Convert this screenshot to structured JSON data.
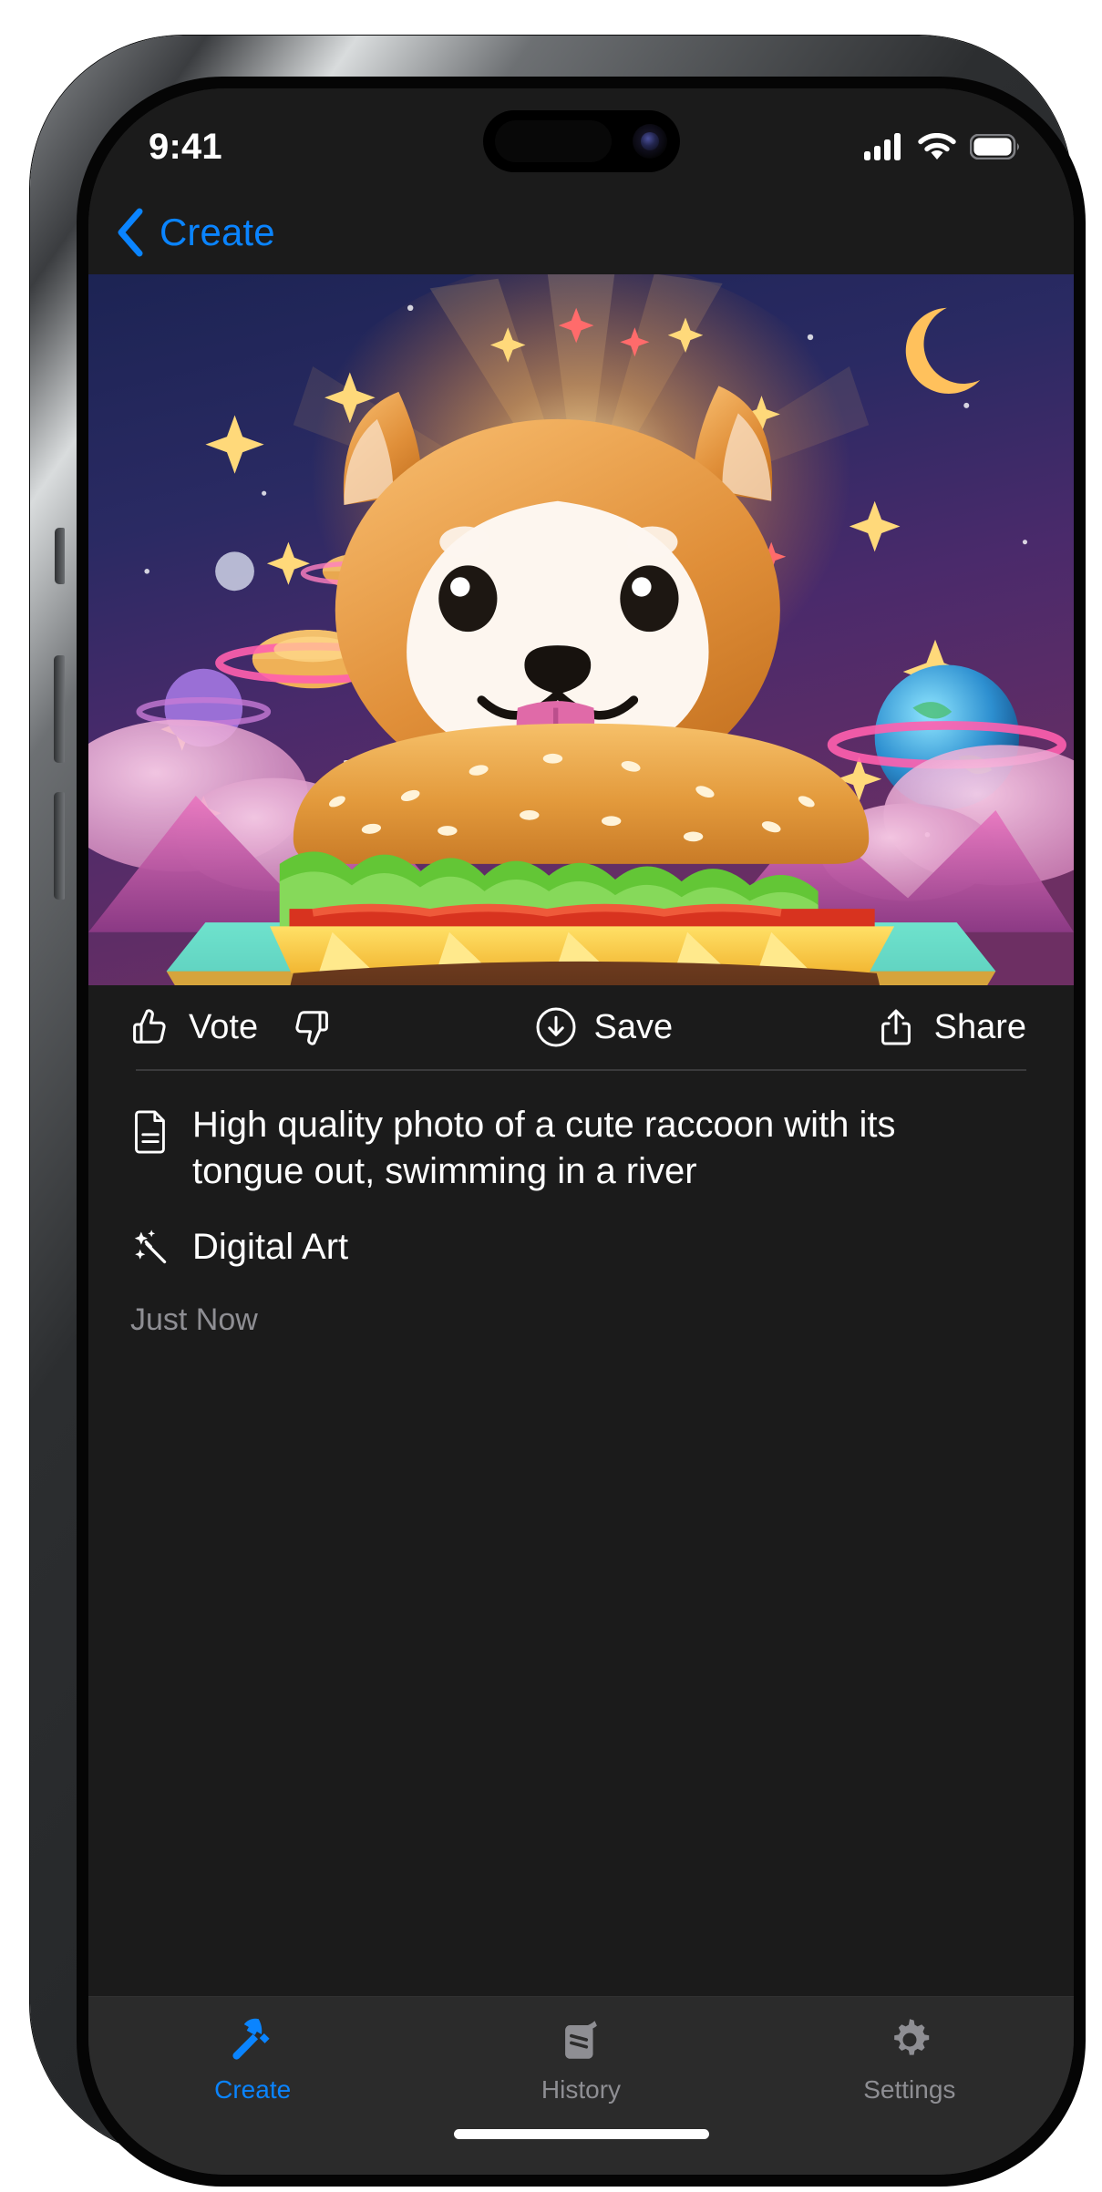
{
  "status_bar": {
    "time": "9:41",
    "icons": [
      "cellular-signal-icon",
      "wifi-icon",
      "battery-icon"
    ],
    "battery_level": 92
  },
  "nav_bar": {
    "back_icon": "chevron-left-icon",
    "back_label": "Create",
    "accent_color": "#0a84ff"
  },
  "hero": {
    "alt": "Shiba inu dog behind a giant cheeseburger floating in a cosmic scene",
    "description": "Generated image preview"
  },
  "actions": {
    "vote": {
      "up_icon": "thumbs-up-icon",
      "label": "Vote",
      "down_icon": "thumbs-down-icon"
    },
    "save": {
      "icon": "download-circle-icon",
      "label": "Save"
    },
    "share": {
      "icon": "share-icon",
      "label": "Share"
    }
  },
  "meta": {
    "prompt_icon": "document-icon",
    "prompt": "High quality photo of a cute raccoon with its tongue out, swimming in a river",
    "style_icon": "sparkles-wand-icon",
    "style": "Digital Art",
    "timestamp": "Just Now"
  },
  "tab_bar": {
    "items": [
      {
        "icon": "hammer-icon",
        "label": "Create",
        "active": true
      },
      {
        "icon": "pages-icon",
        "label": "History",
        "active": false
      },
      {
        "icon": "gear-icon",
        "label": "Settings",
        "active": false
      }
    ],
    "active_color": "#0a84ff",
    "inactive_color": "#8e8e93"
  }
}
